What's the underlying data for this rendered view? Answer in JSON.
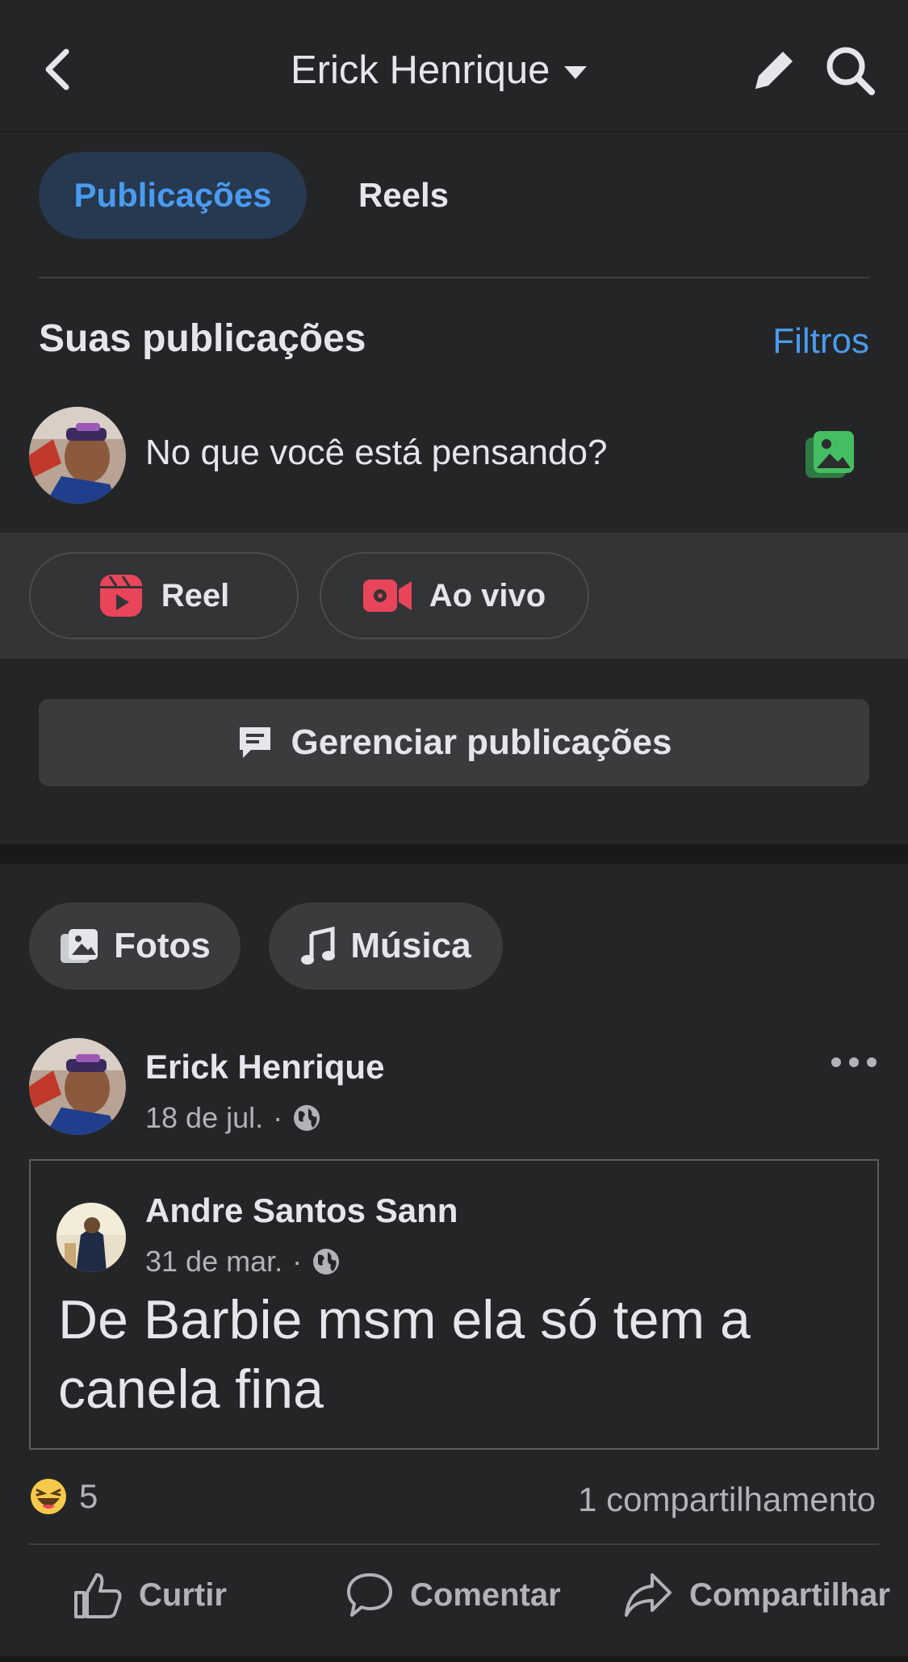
{
  "header": {
    "title": "Erick Henrique"
  },
  "tabs": [
    {
      "label": "Publicações",
      "active": true
    },
    {
      "label": "Reels",
      "active": false
    }
  ],
  "section": {
    "title": "Suas publicações",
    "filters_label": "Filtros"
  },
  "composer": {
    "placeholder": "No que você está pensando?"
  },
  "create_chips": [
    {
      "label": "Reel",
      "icon": "reel-icon"
    },
    {
      "label": "Ao vivo",
      "icon": "live-video-icon"
    }
  ],
  "manage": {
    "label": "Gerenciar publicações"
  },
  "filter_pills": [
    {
      "label": "Fotos",
      "icon": "photos-icon"
    },
    {
      "label": "Música",
      "icon": "music-note-icon"
    }
  ],
  "post": {
    "author": "Erick Henrique",
    "date": "18 de jul.",
    "separator": "·",
    "shared": {
      "author": "Andre Santos Sann",
      "date": "31 de mar.",
      "separator": "·",
      "text": "De Barbie msm ela só tem a canela fina"
    },
    "reaction_count": "5",
    "shares": "1 compartilhamento",
    "actions": {
      "like": "Curtir",
      "comment": "Comentar",
      "share": "Compartilhar"
    }
  },
  "colors": {
    "accent": "#4a9bf0",
    "background": "#242526",
    "reel_red": "#e8455a",
    "photo_green": "#45bd62"
  }
}
